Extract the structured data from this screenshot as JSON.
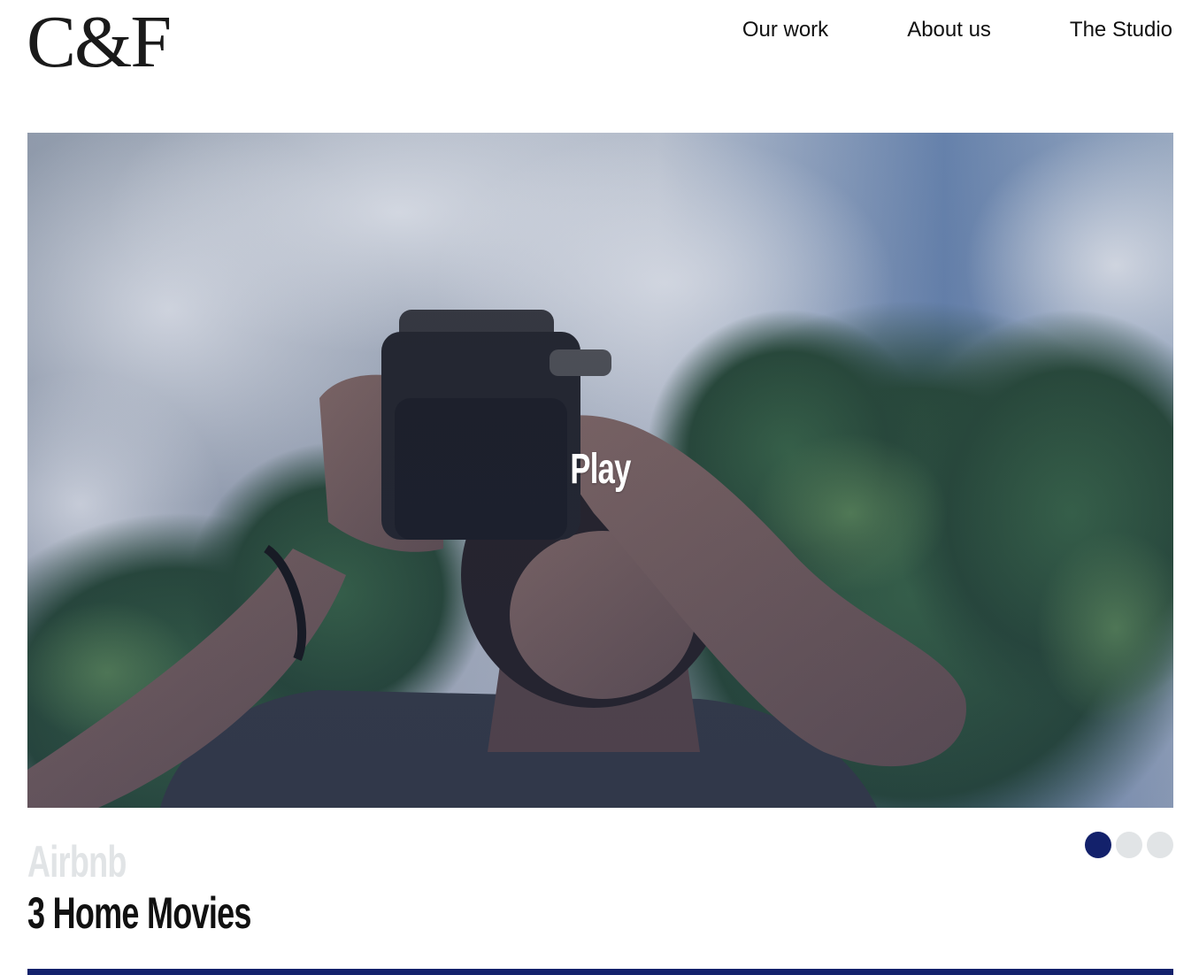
{
  "header": {
    "logo": "C&F",
    "nav": [
      {
        "label": "Our work"
      },
      {
        "label": "About us"
      },
      {
        "label": "The Studio"
      }
    ]
  },
  "hero": {
    "play_label": "Play",
    "image_icon": "hero-video-thumbnail"
  },
  "project": {
    "client": "Airbnb",
    "title": "3 Home Movies"
  },
  "carousel": {
    "slide_count": 3,
    "active_index": 0
  },
  "colors": {
    "accent": "#13216b",
    "dot_inactive": "#e1e4e6",
    "client_text": "#e1e4e6",
    "text": "#111111",
    "background": "#ffffff"
  }
}
